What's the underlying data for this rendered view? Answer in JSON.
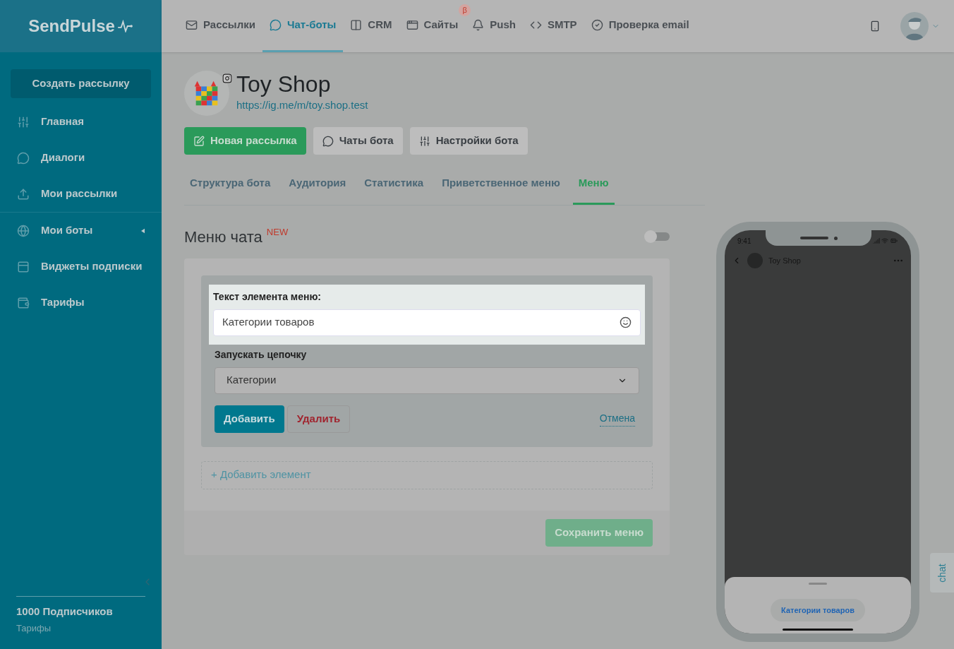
{
  "logo": "SendPulse",
  "top_nav": [
    {
      "label": "Рассылки",
      "selected": false
    },
    {
      "label": "Чат-боты",
      "selected": true
    },
    {
      "label": "CRM",
      "selected": false
    },
    {
      "label": "Сайты",
      "selected": false,
      "badge": "β"
    },
    {
      "label": "Push",
      "selected": false
    },
    {
      "label": "SMTP",
      "selected": false
    },
    {
      "label": "Проверка email",
      "selected": false
    }
  ],
  "sidebar": {
    "create_button": "Создать рассылку",
    "items": [
      {
        "label": "Главная",
        "expandable": false
      },
      {
        "label": "Диалоги",
        "expandable": false
      },
      {
        "label": "Мои рассылки",
        "expandable": false
      },
      {
        "label": "Мои боты",
        "expandable": true
      },
      {
        "label": "Виджеты подписки",
        "expandable": false
      },
      {
        "label": "Тарифы",
        "expandable": false
      }
    ],
    "subscribers": "1000 Подписчиков",
    "plan_link": "Тарифы"
  },
  "bot": {
    "name": "Toy Shop",
    "url": "https://ig.me/m/toy.shop.test"
  },
  "actions": [
    {
      "label": "Новая рассылка",
      "kind": "primary"
    },
    {
      "label": "Чаты бота",
      "kind": "secondary"
    },
    {
      "label": "Настройки бота",
      "kind": "secondary"
    }
  ],
  "tabs": [
    {
      "label": "Структура бота",
      "selected": false
    },
    {
      "label": "Аудитория",
      "selected": false
    },
    {
      "label": "Статистика",
      "selected": false
    },
    {
      "label": "Приветственное меню",
      "selected": false
    },
    {
      "label": "Меню",
      "selected": true
    }
  ],
  "menu_section": {
    "title": "Меню чата",
    "badge": "NEW",
    "enabled": false,
    "item_text_label": "Текст элемента меню:",
    "item_text_value": "Категории товаров",
    "chain_label": "Запускать цепочку",
    "chain_value": "Категории",
    "add_button": "Добавить",
    "delete_button": "Удалить",
    "cancel_link": "Отмена",
    "add_element": "+ Добавить элемент",
    "save_button": "Сохранить меню"
  },
  "phone": {
    "time": "9:41",
    "chat_name": "Toy Shop",
    "menu_item": "Категории товаров"
  },
  "chat_tab": "chat"
}
